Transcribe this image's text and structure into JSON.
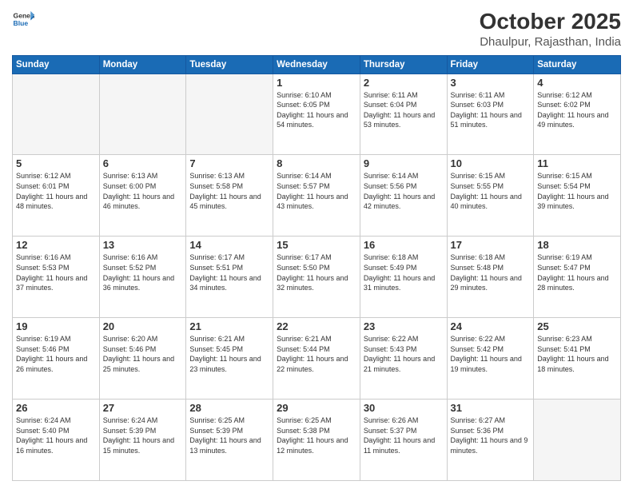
{
  "logo": {
    "general": "General",
    "blue": "Blue"
  },
  "header": {
    "month_title": "October 2025",
    "location": "Dhaulpur, Rajasthan, India"
  },
  "days_of_week": [
    "Sunday",
    "Monday",
    "Tuesday",
    "Wednesday",
    "Thursday",
    "Friday",
    "Saturday"
  ],
  "weeks": [
    [
      {
        "day": "",
        "empty": true
      },
      {
        "day": "",
        "empty": true
      },
      {
        "day": "",
        "empty": true
      },
      {
        "day": "1",
        "sunrise": "6:10 AM",
        "sunset": "6:05 PM",
        "daylight": "11 hours and 54 minutes."
      },
      {
        "day": "2",
        "sunrise": "6:11 AM",
        "sunset": "6:04 PM",
        "daylight": "11 hours and 53 minutes."
      },
      {
        "day": "3",
        "sunrise": "6:11 AM",
        "sunset": "6:03 PM",
        "daylight": "11 hours and 51 minutes."
      },
      {
        "day": "4",
        "sunrise": "6:12 AM",
        "sunset": "6:02 PM",
        "daylight": "11 hours and 49 minutes."
      }
    ],
    [
      {
        "day": "5",
        "sunrise": "6:12 AM",
        "sunset": "6:01 PM",
        "daylight": "11 hours and 48 minutes."
      },
      {
        "day": "6",
        "sunrise": "6:13 AM",
        "sunset": "6:00 PM",
        "daylight": "11 hours and 46 minutes."
      },
      {
        "day": "7",
        "sunrise": "6:13 AM",
        "sunset": "5:58 PM",
        "daylight": "11 hours and 45 minutes."
      },
      {
        "day": "8",
        "sunrise": "6:14 AM",
        "sunset": "5:57 PM",
        "daylight": "11 hours and 43 minutes."
      },
      {
        "day": "9",
        "sunrise": "6:14 AM",
        "sunset": "5:56 PM",
        "daylight": "11 hours and 42 minutes."
      },
      {
        "day": "10",
        "sunrise": "6:15 AM",
        "sunset": "5:55 PM",
        "daylight": "11 hours and 40 minutes."
      },
      {
        "day": "11",
        "sunrise": "6:15 AM",
        "sunset": "5:54 PM",
        "daylight": "11 hours and 39 minutes."
      }
    ],
    [
      {
        "day": "12",
        "sunrise": "6:16 AM",
        "sunset": "5:53 PM",
        "daylight": "11 hours and 37 minutes."
      },
      {
        "day": "13",
        "sunrise": "6:16 AM",
        "sunset": "5:52 PM",
        "daylight": "11 hours and 36 minutes."
      },
      {
        "day": "14",
        "sunrise": "6:17 AM",
        "sunset": "5:51 PM",
        "daylight": "11 hours and 34 minutes."
      },
      {
        "day": "15",
        "sunrise": "6:17 AM",
        "sunset": "5:50 PM",
        "daylight": "11 hours and 32 minutes."
      },
      {
        "day": "16",
        "sunrise": "6:18 AM",
        "sunset": "5:49 PM",
        "daylight": "11 hours and 31 minutes."
      },
      {
        "day": "17",
        "sunrise": "6:18 AM",
        "sunset": "5:48 PM",
        "daylight": "11 hours and 29 minutes."
      },
      {
        "day": "18",
        "sunrise": "6:19 AM",
        "sunset": "5:47 PM",
        "daylight": "11 hours and 28 minutes."
      }
    ],
    [
      {
        "day": "19",
        "sunrise": "6:19 AM",
        "sunset": "5:46 PM",
        "daylight": "11 hours and 26 minutes."
      },
      {
        "day": "20",
        "sunrise": "6:20 AM",
        "sunset": "5:46 PM",
        "daylight": "11 hours and 25 minutes."
      },
      {
        "day": "21",
        "sunrise": "6:21 AM",
        "sunset": "5:45 PM",
        "daylight": "11 hours and 23 minutes."
      },
      {
        "day": "22",
        "sunrise": "6:21 AM",
        "sunset": "5:44 PM",
        "daylight": "11 hours and 22 minutes."
      },
      {
        "day": "23",
        "sunrise": "6:22 AM",
        "sunset": "5:43 PM",
        "daylight": "11 hours and 21 minutes."
      },
      {
        "day": "24",
        "sunrise": "6:22 AM",
        "sunset": "5:42 PM",
        "daylight": "11 hours and 19 minutes."
      },
      {
        "day": "25",
        "sunrise": "6:23 AM",
        "sunset": "5:41 PM",
        "daylight": "11 hours and 18 minutes."
      }
    ],
    [
      {
        "day": "26",
        "sunrise": "6:24 AM",
        "sunset": "5:40 PM",
        "daylight": "11 hours and 16 minutes."
      },
      {
        "day": "27",
        "sunrise": "6:24 AM",
        "sunset": "5:39 PM",
        "daylight": "11 hours and 15 minutes."
      },
      {
        "day": "28",
        "sunrise": "6:25 AM",
        "sunset": "5:39 PM",
        "daylight": "11 hours and 13 minutes."
      },
      {
        "day": "29",
        "sunrise": "6:25 AM",
        "sunset": "5:38 PM",
        "daylight": "11 hours and 12 minutes."
      },
      {
        "day": "30",
        "sunrise": "6:26 AM",
        "sunset": "5:37 PM",
        "daylight": "11 hours and 11 minutes."
      },
      {
        "day": "31",
        "sunrise": "6:27 AM",
        "sunset": "5:36 PM",
        "daylight": "11 hours and 9 minutes."
      },
      {
        "day": "",
        "empty": true
      }
    ]
  ],
  "labels": {
    "sunrise": "Sunrise:",
    "sunset": "Sunset:",
    "daylight": "Daylight:"
  },
  "colors": {
    "header_bg": "#1a6bb5",
    "accent": "#1a6bb5"
  }
}
